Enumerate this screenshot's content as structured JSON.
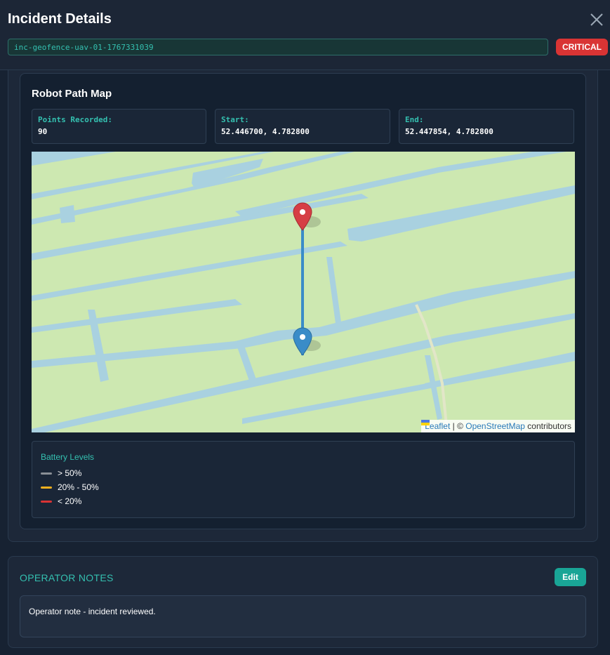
{
  "modal": {
    "title": "Incident Details",
    "incident_id": "inc-geofence-uav-01-1767331039",
    "severity": "CRITICAL"
  },
  "map": {
    "title": "Robot Path Map",
    "points_label": "Points Recorded:",
    "points_value": "90",
    "start_label": "Start:",
    "start_value": "52.446700, 4.782800",
    "end_label": "End:",
    "end_value": "52.447854, 4.782800",
    "attribution": {
      "leaflet": "Leaflet",
      "separator": " | © ",
      "osm": "OpenStreetMap",
      "suffix": " contributors"
    }
  },
  "legend": {
    "title": "Battery Levels",
    "items": [
      {
        "label": "> 50%",
        "color": "#8a8f96"
      },
      {
        "label": "20% - 50%",
        "color": "#f2b01e"
      },
      {
        "label": "< 20%",
        "color": "#d93434"
      }
    ]
  },
  "notes": {
    "title": "OPERATOR NOTES",
    "edit_label": "Edit",
    "text": "Operator note - incident reviewed."
  },
  "colors": {
    "accent": "#34c0b0",
    "critical": "#d93434",
    "path": "#3a8cc8",
    "start_marker": "#3a8cc8",
    "end_marker": "#d63e45"
  },
  "icons": {
    "close": "close-icon",
    "start_marker": "map-marker-blue-icon",
    "end_marker": "map-marker-red-icon",
    "flag": "ukraine-flag-icon"
  }
}
